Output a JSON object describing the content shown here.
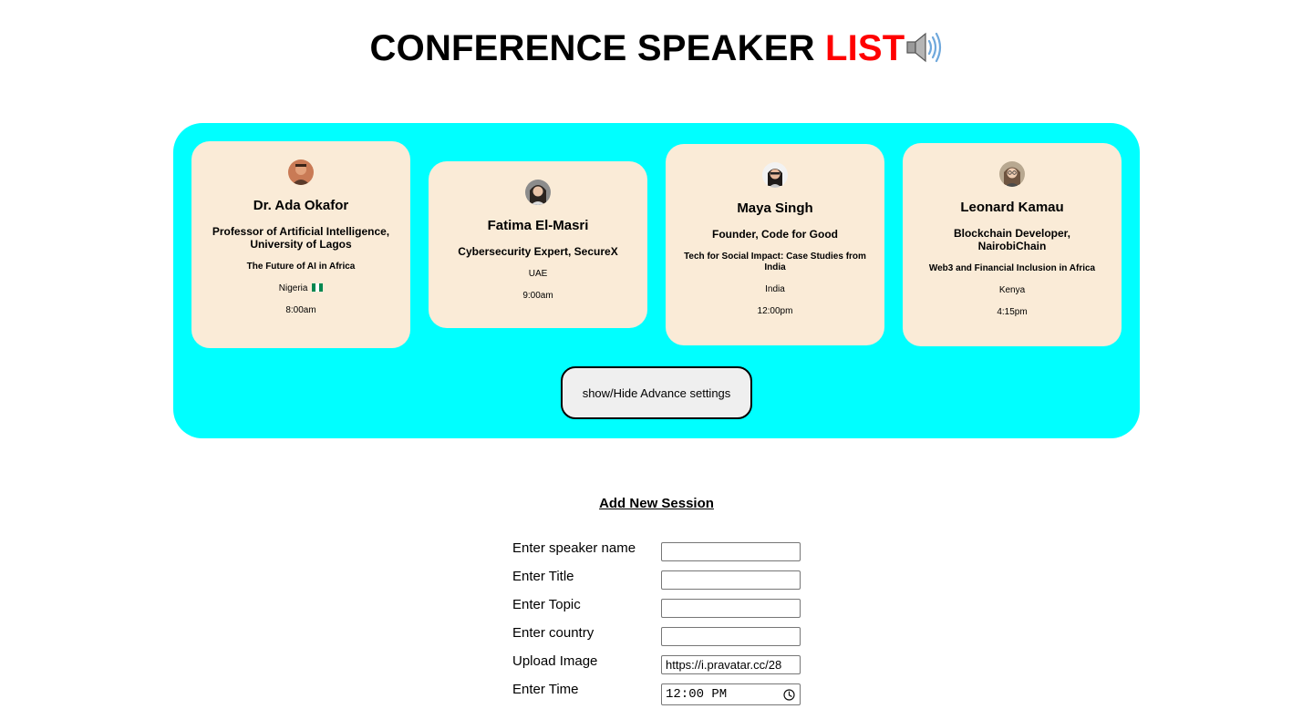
{
  "header": {
    "title_main": "CONFERENCE SPEAKER ",
    "title_accent": "LIST"
  },
  "speakers": [
    {
      "name": "Dr. Ada Okafor",
      "role": "Professor of Artificial Intelligence, University of Lagos",
      "topic": "The Future of AI in Africa",
      "country": "Nigeria",
      "time": "8:00am"
    },
    {
      "name": "Fatima El-Masri",
      "role": "Cybersecurity Expert, SecureX",
      "topic": "",
      "country": "UAE",
      "time": "9:00am"
    },
    {
      "name": "Maya Singh",
      "role": "Founder, Code for Good",
      "topic": "Tech for Social Impact: Case Studies from India",
      "country": "India",
      "time": "12:00pm"
    },
    {
      "name": "Leonard Kamau",
      "role": "Blockchain Developer, NairobiChain",
      "topic": "Web3 and Financial Inclusion in Africa",
      "country": "Kenya",
      "time": "4:15pm"
    }
  ],
  "toggle_button": {
    "label": "show/Hide Advance settings"
  },
  "form": {
    "heading": "Add New Session",
    "fields": [
      {
        "label": "Enter speaker name",
        "value": ""
      },
      {
        "label": "Enter Title",
        "value": ""
      },
      {
        "label": "Enter Topic",
        "value": ""
      },
      {
        "label": "Enter country",
        "value": ""
      },
      {
        "label": "Upload Image",
        "value": "https://i.pravatar.cc/28"
      },
      {
        "label": "Enter Time",
        "value": "12:00 PM"
      }
    ]
  },
  "colors": {
    "accent": "#ff0000",
    "panel": "#00ffff",
    "card": "#faebd7"
  }
}
